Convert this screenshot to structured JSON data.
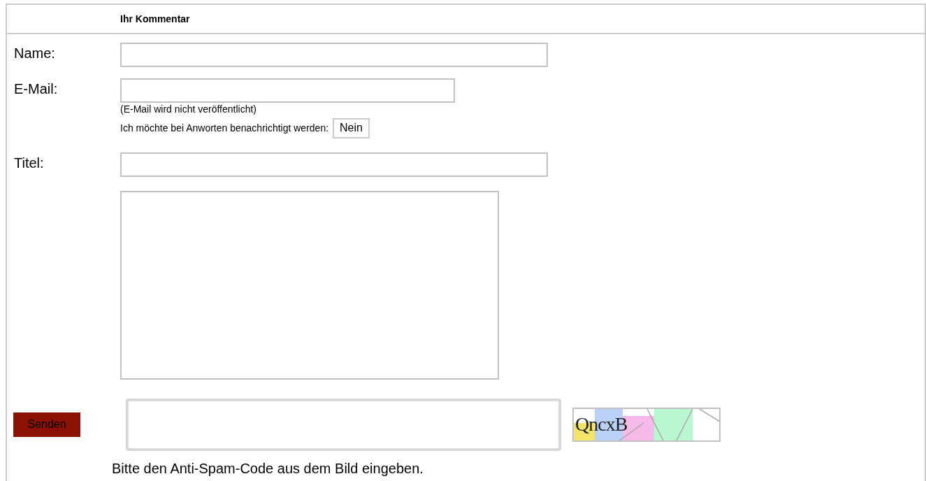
{
  "form": {
    "heading": "Ihr Kommentar",
    "fields": [
      {
        "kind": "text",
        "label": "Name:"
      },
      {
        "kind": "email",
        "label": "E-Mail:",
        "note": "(E-Mail wird nicht veröffentlicht)",
        "notify_label": "Ich möchte bei Anworten benachrichtigt werden:",
        "notify_value": "Nein"
      },
      {
        "kind": "text",
        "label": "Titel:"
      },
      {
        "kind": "textarea"
      }
    ],
    "submit": "Senden",
    "captcha": {
      "code": "QncxB",
      "hint": "Bitte den Anti-Spam-Code aus dem Bild eingeben."
    }
  }
}
